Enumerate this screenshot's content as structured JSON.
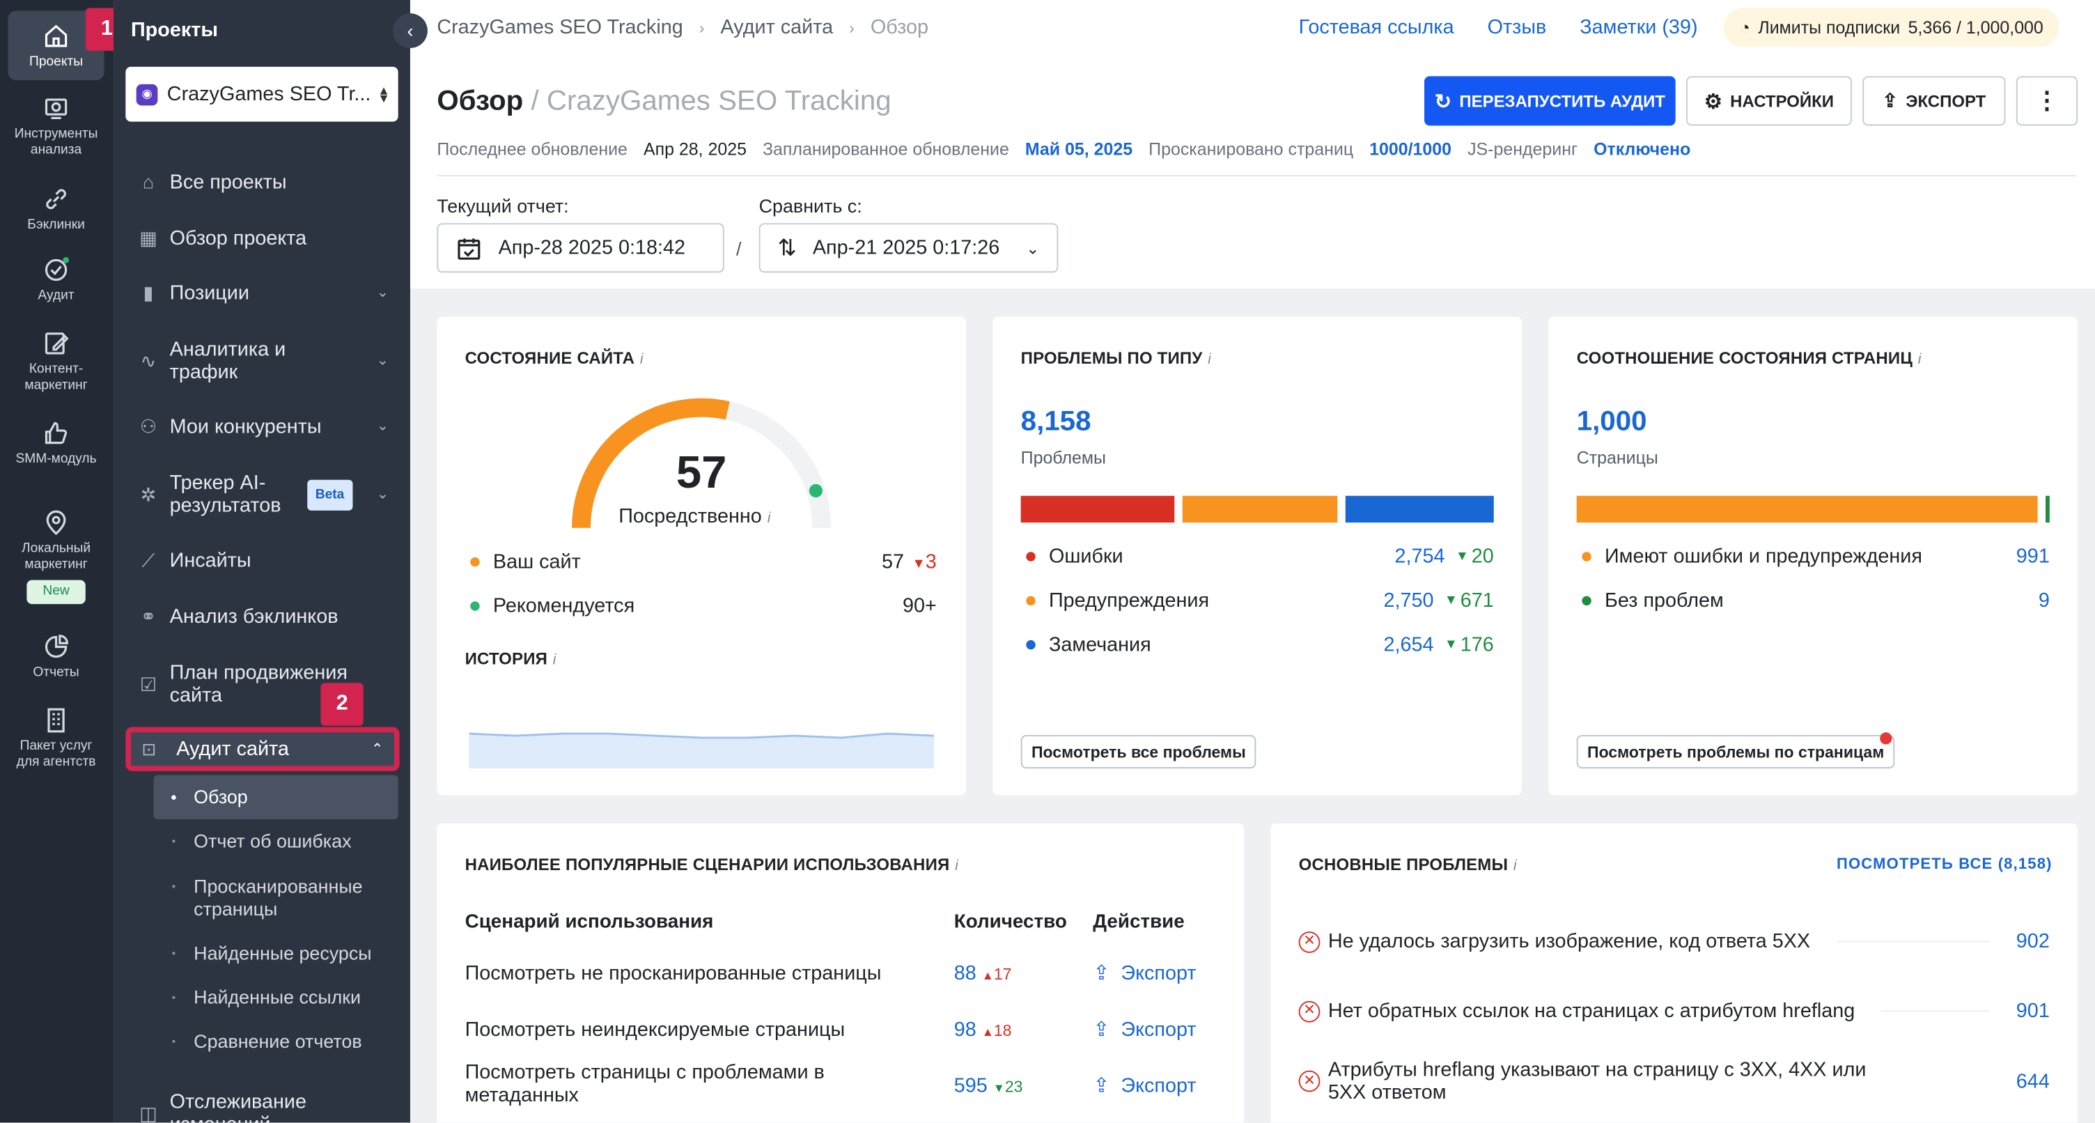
{
  "rail": {
    "items": [
      {
        "label": "Проекты",
        "icon": "home-icon"
      },
      {
        "label": "Инструменты анализа",
        "icon": "analysis-icon"
      },
      {
        "label": "Бэклинки",
        "icon": "link-icon"
      },
      {
        "label": "Аудит",
        "icon": "audit-icon"
      },
      {
        "label": "Контент-маркетинг",
        "icon": "edit-icon"
      },
      {
        "label": "SMM-модуль",
        "icon": "thumbs-up-icon"
      },
      {
        "label": "Локальный маркетинг",
        "icon": "location-icon"
      },
      {
        "label": "Отчеты",
        "icon": "pie-icon"
      },
      {
        "label": "Пакет услуг для агентств",
        "icon": "building-icon"
      }
    ],
    "new_badge": "New"
  },
  "markers": {
    "one": "1",
    "two": "2"
  },
  "sidebar": {
    "title": "Проекты",
    "project": "CrazyGames SEO Tr...",
    "items": [
      {
        "label": "Все проекты"
      },
      {
        "label": "Обзор проекта"
      },
      {
        "label": "Позиции"
      },
      {
        "label": "Аналитика и трафик"
      },
      {
        "label": "Мои конкуренты"
      },
      {
        "label": "Трекер AI-результатов",
        "badge": "Beta"
      },
      {
        "label": "Инсайты"
      },
      {
        "label": "Анализ бэклинков"
      },
      {
        "label": "План продвижения сайта"
      },
      {
        "label": "Аудит сайта"
      },
      {
        "label": "Отслеживание изменений"
      }
    ],
    "subitems": [
      "Обзор",
      "Отчет об ошибках",
      "Просканированные страницы",
      "Найденные ресурсы",
      "Найденные ссылки",
      "Сравнение отчетов"
    ]
  },
  "header": {
    "crumbs": [
      "CrazyGames SEO Tracking",
      "Аудит сайта",
      "Обзор"
    ],
    "links": [
      "Гостевая ссылка",
      "Отзыв",
      "Заметки (39)"
    ],
    "limits_label": "Лимиты подписки",
    "limits_value": "5,366 / 1,000,000",
    "title": "Обзор",
    "title_sub": "/ CrazyGames SEO Tracking",
    "restart": "ПЕРЕЗАПУСТИТЬ АУДИТ",
    "settings": "НАСТРОЙКИ",
    "export": "ЭКСПОРТ",
    "meta": {
      "last_label": "Последнее обновление",
      "last": "Апр 28, 2025",
      "next_label": "Запланированное обновление",
      "next": "Май 05, 2025",
      "pages_label": "Просканировано страниц",
      "pages": "1000/1000",
      "js_label": "JS-рендеринг",
      "js": "Отключено"
    },
    "current_label": "Текущий отчет:",
    "current": "Апр-28 2025 0:18:42",
    "compare_label": "Сравнить с:",
    "compare": "Апр-21 2025 0:17:26",
    "slash": "/"
  },
  "health": {
    "title": "СОСТОЯНИЕ САЙТА",
    "score": "57",
    "score_value": 57,
    "recommended_value": 90,
    "status": "Посредственно",
    "your_site": "Ваш сайт",
    "your_val": "57",
    "your_delta": "3",
    "recommended": "Рекомендуется",
    "rec_val": "90+",
    "history": "ИСТОРИЯ",
    "history_points": [
      57,
      56,
      57,
      57,
      56,
      55,
      55,
      56,
      55,
      57,
      56
    ],
    "colors": {
      "score": "#f7931e",
      "recommended": "#2bb673"
    }
  },
  "issues": {
    "title": "ПРОБЛЕМЫ ПО ТИПУ",
    "total": "8,158",
    "total_label": "Проблемы",
    "rows": [
      {
        "label": "Ошибки",
        "val": "2,754",
        "delta": "20",
        "color": "#d93025"
      },
      {
        "label": "Предупреждения",
        "val": "2,750",
        "delta": "671",
        "color": "#f7931e"
      },
      {
        "label": "Замечания",
        "val": "2,654",
        "delta": "176",
        "color": "#1967d2"
      }
    ],
    "button": "Посмотреть все проблемы"
  },
  "ratio": {
    "title": "СООТНОШЕНИЕ СОСТОЯНИЯ СТРАНИЦ",
    "total": "1,000",
    "total_label": "Страницы",
    "rows": [
      {
        "label": "Имеют ошибки и предупреждения",
        "val": "991",
        "color": "#f7931e"
      },
      {
        "label": "Без проблем",
        "val": "9",
        "color": "#1e8e3e"
      }
    ],
    "button": "Посмотреть проблемы по страницам"
  },
  "usecases": {
    "title": "НАИБОЛЕЕ ПОПУЛЯРНЫЕ СЦЕНАРИИ ИСПОЛЬЗОВАНИЯ",
    "headers": [
      "Сценарий использования",
      "Количество",
      "Действие"
    ],
    "rows": [
      {
        "label": "Посмотреть не просканированные страницы",
        "count": "88",
        "delta": "17",
        "dir": "up",
        "action": "Экспорт"
      },
      {
        "label": "Посмотреть неиндексируемые страницы",
        "count": "98",
        "delta": "18",
        "dir": "up",
        "action": "Экспорт"
      },
      {
        "label": "Посмотреть страницы с проблемами в метаданных",
        "count": "595",
        "delta": "23",
        "dir": "down",
        "action": "Экспорт"
      }
    ]
  },
  "main_issues": {
    "title": "ОСНОВНЫЕ ПРОБЛЕМЫ",
    "view_all": "ПОСМОТРЕТЬ ВСЕ (8,158)",
    "rows": [
      {
        "label": "Не удалось загрузить изображение, код ответа 5XX",
        "val": "902"
      },
      {
        "label": "Нет обратных ссылок на страницах с атрибутом hreflang",
        "val": "901"
      },
      {
        "label": "Атрибуты hreflang указывают на страницу с 3XX, 4XX или 5XX ответом",
        "val": "644"
      }
    ]
  },
  "info_glyph": "i"
}
